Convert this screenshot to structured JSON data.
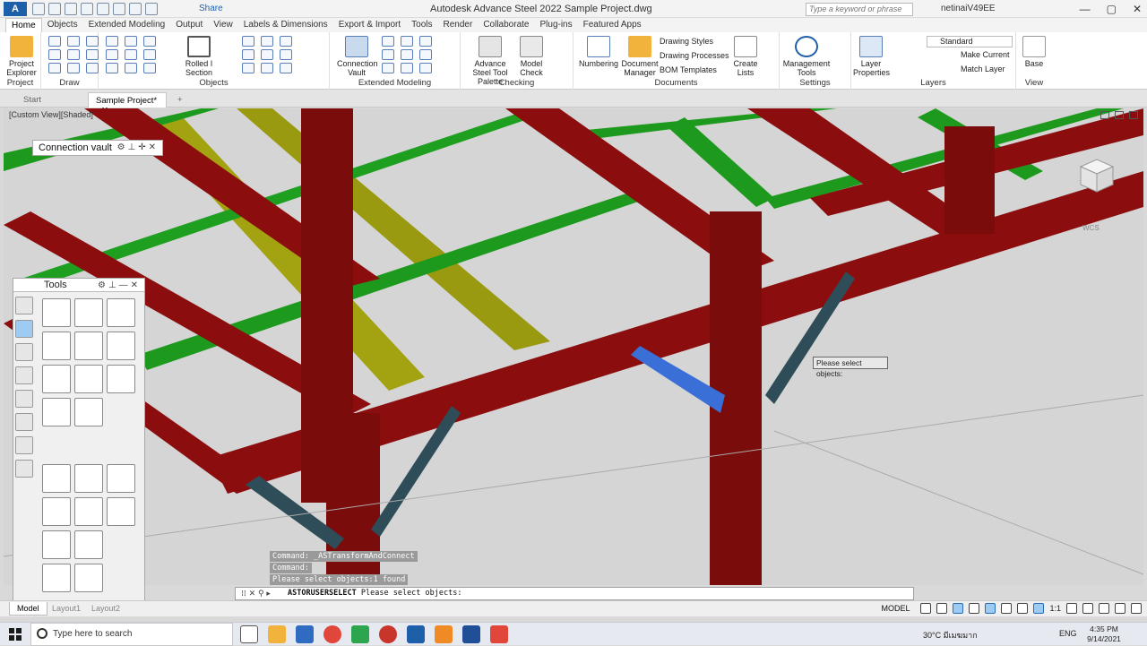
{
  "app": {
    "window_title": "Autodesk Advance Steel 2022   Sample Project.dwg",
    "share_label": "Share",
    "search_placeholder": "Type a keyword or phrase",
    "user_name": "netinaiV49EE"
  },
  "ribbon_tabs": [
    "Home",
    "Objects",
    "Extended Modeling",
    "Output",
    "View",
    "Labels & Dimensions",
    "Export & Import",
    "Tools",
    "Render",
    "Collaborate",
    "Plug-ins",
    "Featured Apps"
  ],
  "ribbon": {
    "project_explorer": "Project Explorer",
    "rolled_section": "Rolled I Section",
    "connection_vault": "Connection Vault",
    "advance_steel_tool_palette": "Advance Steel Tool Palette",
    "model_check": "Model Check",
    "numbering": "Numbering",
    "document_manager": "Document Manager",
    "drawing_styles": "Drawing Styles",
    "drawing_processes": "Drawing Processes",
    "bom_templates": "BOM Templates",
    "create_lists": "Create Lists",
    "management_tools": "Management Tools",
    "layer_properties": "Layer Properties",
    "layer_dropdown": "Standard",
    "make_current": "Make Current",
    "match_layer": "Match Layer",
    "base": "Base",
    "panel_labels": {
      "project": "Project",
      "draw": "Draw",
      "objects": "Objects",
      "extended_modeling": "Extended Modeling",
      "checking": "Checking",
      "documents": "Documents",
      "settings": "Settings",
      "layers": "Layers",
      "view": "View"
    }
  },
  "doc_tabs": {
    "start": "Start",
    "active": "Sample Project*"
  },
  "viewport": {
    "label": "[Custom View][Shaded]",
    "wcs": "WCS"
  },
  "connection_vault_palette": {
    "title": "Connection vault"
  },
  "tools_palette": {
    "title": "Tools"
  },
  "tooltip": "Please select objects:",
  "command": {
    "history": [
      "Command:  _ASTransformAndConnect",
      "Command:",
      "Please select objects:1 found"
    ],
    "current_cmd": "ASTORUSERSELECT",
    "current_prompt": "Please select objects:"
  },
  "layout_tabs": [
    "Model",
    "Layout1",
    "Layout2"
  ],
  "status": {
    "model": "MODEL",
    "scale": "1:1"
  },
  "taskbar": {
    "search": "Type here to search",
    "weather": "30°C  มีเมฆมาก",
    "lang": "ENG",
    "time": "4:35 PM",
    "date": "9/14/2021"
  },
  "colors": {
    "beam_red": "#8b0d0d",
    "beam_green": "#1d9a1d",
    "beam_yellow": "#9a9a10",
    "brace_teal": "#2f4d58",
    "selected_blue": "#3a6fd8",
    "viewport_bg": "#d5d5d5"
  }
}
